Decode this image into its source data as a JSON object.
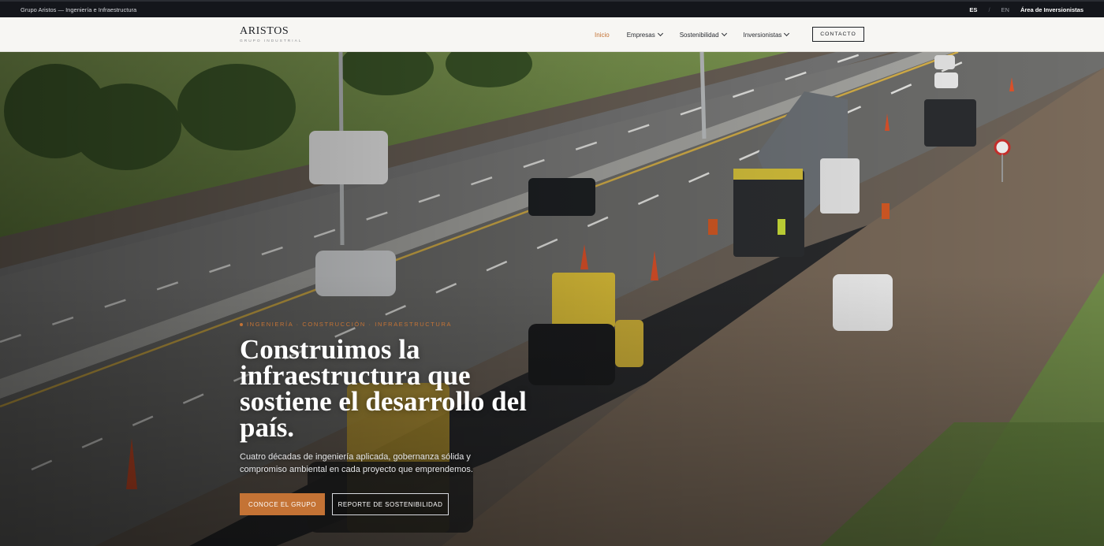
{
  "topbar": {
    "company": "Grupo Aristos — Ingeniería e Infraestructura",
    "lang_es": "ES",
    "separator": "/",
    "lang_en": "EN",
    "investors_area": "Área de Inversionistas"
  },
  "header": {
    "logo": "ARISTOS",
    "logo_sub": "GRUPO INDUSTRIAL",
    "nav": [
      {
        "label": "Inicio",
        "active": true
      },
      {
        "label": "Empresas"
      },
      {
        "label": "Sostenibilidad"
      },
      {
        "label": "Inversionistas"
      }
    ],
    "contact_label": "CONTACTO"
  },
  "hero": {
    "eyebrow": "INGENIERÍA · CONSTRUCCIÓN · INFRAESTRUCTURA",
    "title": "Construimos la infraestructura que sostiene el desarrollo del país.",
    "description": "Cuatro décadas de ingeniería aplicada, gobernanza sólida y compromiso ambiental en cada proyecto que emprendemos.",
    "primary_cta": "CONOCE EL GRUPO",
    "secondary_cta": "REPORTE DE SOSTENIBILIDAD",
    "background": "highway-paving-photo"
  },
  "colors": {
    "accent": "#c47335",
    "topbar_bg": "#14161b",
    "header_bg": "#f7f6f3"
  }
}
